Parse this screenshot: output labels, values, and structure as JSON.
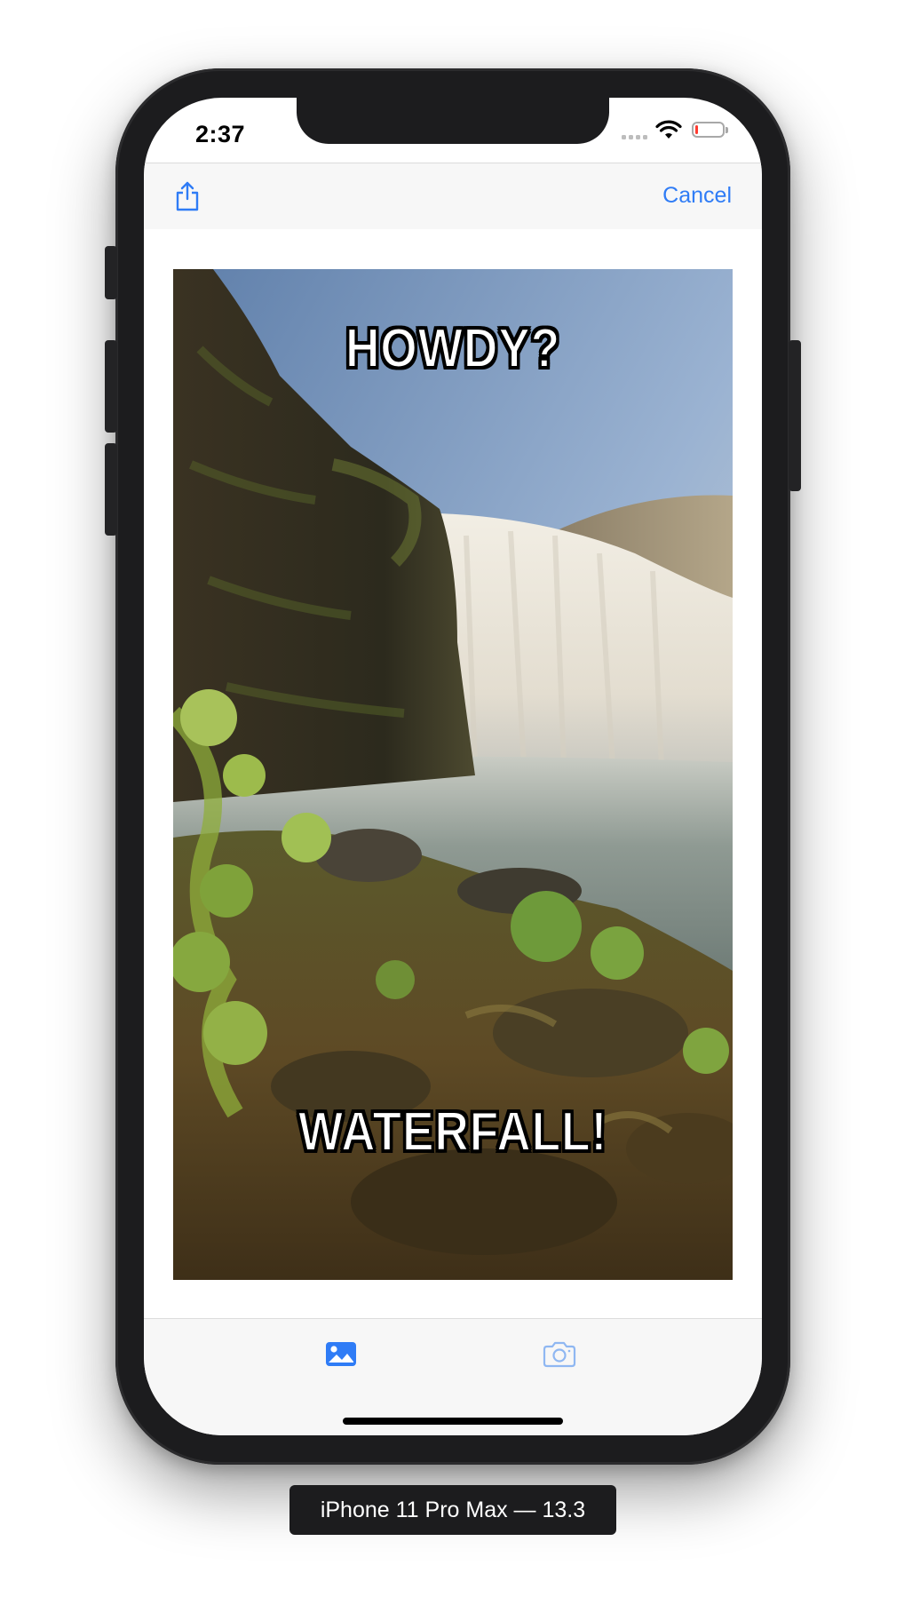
{
  "status_bar": {
    "time": "2:37",
    "battery_level": 0.12,
    "battery_color": "#ff3b30"
  },
  "nav_bar": {
    "share_icon": "share-icon",
    "cancel_label": "Cancel",
    "accent_color": "#2f7cf6"
  },
  "meme": {
    "top_text": "HOWDY?",
    "bottom_text": "WATERFALL!",
    "image_subject": "waterfall with mossy rocks"
  },
  "toolbar": {
    "photo_library_icon": "photo-library-icon",
    "camera_icon": "camera-icon"
  },
  "device": {
    "label": "iPhone 11 Pro Max — 13.3"
  }
}
